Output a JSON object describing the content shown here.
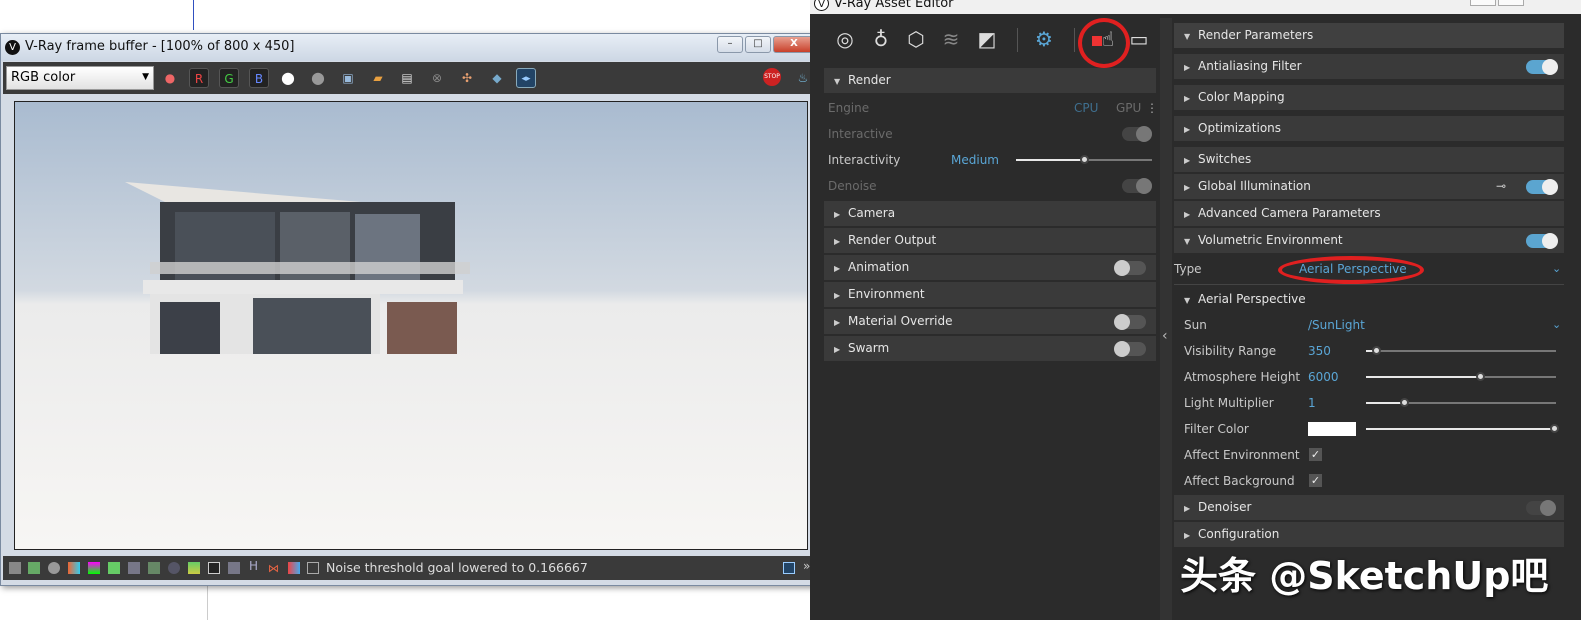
{
  "frame_buffer": {
    "title": "V-Ray frame buffer - [100% of 800 x 450]",
    "window_buttons": {
      "minimize": "–",
      "maximize": "□",
      "close": "X"
    },
    "channel_select": "RGB color",
    "channel_buttons": [
      "R",
      "G",
      "B"
    ],
    "status_text": "Noise threshold goal lowered to 0.166667",
    "status_h_label": "H",
    "stop_label": "STOP"
  },
  "asset_editor": {
    "title": "V-Ray Asset Editor",
    "icons": [
      "materials-icon",
      "lights-icon",
      "geometry-icon",
      "layers-icon",
      "textures-icon",
      "settings-icon",
      "render-interactive-icon",
      "frame-buffer-icon"
    ],
    "accent": "#5aa6d6",
    "left_panel": {
      "render_header": "Render",
      "engine_label": "Engine",
      "engine_cpu": "CPU",
      "engine_gpu": "GPU",
      "interactive_label": "Interactive",
      "interactivity_label": "Interactivity",
      "interactivity_value": "Medium",
      "interactivity_level": 0.5,
      "denoise_label": "Denoise",
      "sections": [
        {
          "label": "Camera",
          "toggle": null
        },
        {
          "label": "Render Output",
          "toggle": null
        },
        {
          "label": "Animation",
          "toggle": false
        },
        {
          "label": "Environment",
          "toggle": null
        },
        {
          "label": "Material Override",
          "toggle": false
        },
        {
          "label": "Swarm",
          "toggle": false
        }
      ]
    },
    "right_panel": {
      "header": "Render Parameters",
      "sections": [
        {
          "label": "Antialiasing Filter",
          "toggle": true
        },
        {
          "label": "Color Mapping",
          "toggle": null
        },
        {
          "label": "Optimizations",
          "toggle": null
        },
        {
          "label": "Switches",
          "toggle": null
        },
        {
          "label": "Global Illumination",
          "toggle": true
        },
        {
          "label": "Advanced Camera Parameters",
          "toggle": null
        },
        {
          "label": "Volumetric Environment",
          "toggle": true
        }
      ],
      "type_label": "Type",
      "type_value": "Aerial Perspective",
      "aerial_header": "Aerial Perspective",
      "sun_label": "Sun",
      "sun_value": "/SunLight",
      "params": [
        {
          "label": "Visibility Range",
          "value": "350",
          "level": 0.05
        },
        {
          "label": "Atmosphere Height",
          "value": "6000",
          "level": 0.6
        },
        {
          "label": "Light Multiplier",
          "value": "1",
          "level": 0.2
        }
      ],
      "filter_color_label": "Filter Color",
      "filter_color": "#ffffff",
      "affect_environment_label": "Affect Environment",
      "affect_environment": true,
      "affect_background_label": "Affect Background",
      "affect_background": true,
      "denoiser_label": "Denoiser",
      "denoiser_toggle": false,
      "configuration_label": "Configuration"
    }
  },
  "watermark": "头条 @SketchUp吧"
}
